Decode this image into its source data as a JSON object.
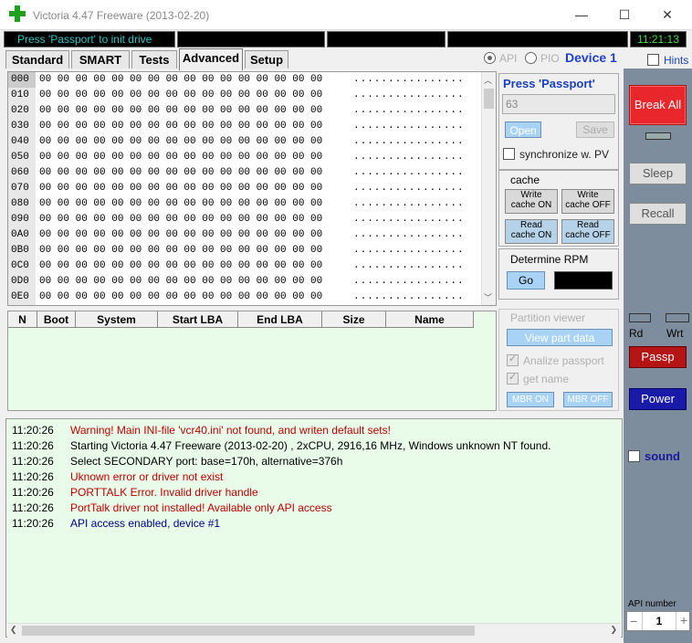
{
  "window": {
    "title": "Victoria 4.47  Freeware (2013-02-20)",
    "minimize": "—",
    "maximize": "☐",
    "close": "✕"
  },
  "status": {
    "message": "Press 'Passport' to init drive",
    "clock": "11:21:13"
  },
  "tabs": [
    {
      "label": "Standard"
    },
    {
      "label": "SMART"
    },
    {
      "label": "Tests"
    },
    {
      "label": "Advanced"
    },
    {
      "label": "Setup"
    }
  ],
  "mode": {
    "api": "API",
    "pio": "PIO",
    "device": "Device 1",
    "hints": "Hints"
  },
  "hex": {
    "rows": [
      {
        "addr": "000",
        "bytes": "00 00 00 00 00 00 00 00 00 00 00 00 00 00 00 00",
        "ascii": "................"
      },
      {
        "addr": "010",
        "bytes": "00 00 00 00 00 00 00 00 00 00 00 00 00 00 00 00",
        "ascii": "................"
      },
      {
        "addr": "020",
        "bytes": "00 00 00 00 00 00 00 00 00 00 00 00 00 00 00 00",
        "ascii": "................"
      },
      {
        "addr": "030",
        "bytes": "00 00 00 00 00 00 00 00 00 00 00 00 00 00 00 00",
        "ascii": "................"
      },
      {
        "addr": "040",
        "bytes": "00 00 00 00 00 00 00 00 00 00 00 00 00 00 00 00",
        "ascii": "................"
      },
      {
        "addr": "050",
        "bytes": "00 00 00 00 00 00 00 00 00 00 00 00 00 00 00 00",
        "ascii": "................"
      },
      {
        "addr": "060",
        "bytes": "00 00 00 00 00 00 00 00 00 00 00 00 00 00 00 00",
        "ascii": "................"
      },
      {
        "addr": "070",
        "bytes": "00 00 00 00 00 00 00 00 00 00 00 00 00 00 00 00",
        "ascii": "................"
      },
      {
        "addr": "080",
        "bytes": "00 00 00 00 00 00 00 00 00 00 00 00 00 00 00 00",
        "ascii": "................"
      },
      {
        "addr": "090",
        "bytes": "00 00 00 00 00 00 00 00 00 00 00 00 00 00 00 00",
        "ascii": "................"
      },
      {
        "addr": "0A0",
        "bytes": "00 00 00 00 00 00 00 00 00 00 00 00 00 00 00 00",
        "ascii": "................"
      },
      {
        "addr": "0B0",
        "bytes": "00 00 00 00 00 00 00 00 00 00 00 00 00 00 00 00",
        "ascii": "................"
      },
      {
        "addr": "0C0",
        "bytes": "00 00 00 00 00 00 00 00 00 00 00 00 00 00 00 00",
        "ascii": "................"
      },
      {
        "addr": "0D0",
        "bytes": "00 00 00 00 00 00 00 00 00 00 00 00 00 00 00 00",
        "ascii": "................"
      },
      {
        "addr": "0E0",
        "bytes": "00 00 00 00 00 00 00 00 00 00 00 00 00 00 00 00",
        "ascii": "................"
      }
    ]
  },
  "passport": {
    "title": "Press 'Passport'",
    "value": "63",
    "open": "Open",
    "save": "Save",
    "sync": "synchronize w. PV"
  },
  "cache": {
    "title": "cache",
    "write_on": [
      "Write",
      "cache ON"
    ],
    "write_off": [
      "Write",
      "cache OFF"
    ],
    "read_on": [
      "Read",
      "cache ON"
    ],
    "read_off": [
      "Read",
      "cache OFF"
    ]
  },
  "rpm": {
    "title": "Determine RPM",
    "go": "Go"
  },
  "partition_table": {
    "columns": [
      "N",
      "Boot",
      "System",
      "Start LBA",
      "End LBA",
      "Size",
      "Name"
    ]
  },
  "partition_viewer": {
    "title": "Partition viewer",
    "view": "View part data",
    "analize": "Analize passport",
    "getname": "get name",
    "mbr_on": "MBR ON",
    "mbr_off": "MBR OFF"
  },
  "log": [
    {
      "time": "11:20:26",
      "msg": "Warning! Main INI-file 'vcr40.ini' not found, and writen default sets!",
      "color": "#c00000"
    },
    {
      "time": "11:20:26",
      "msg": "Starting Victoria 4.47  Freeware (2013-02-20) , 2xCPU, 2916,16 MHz, Windows unknown NT found.",
      "color": "#000000"
    },
    {
      "time": "11:20:26",
      "msg": "Select SECONDARY port: base=170h, alternative=376h",
      "color": "#000000"
    },
    {
      "time": "11:20:26",
      "msg": "Uknown error or driver not exist",
      "color": "#c00000"
    },
    {
      "time": "11:20:26",
      "msg": "PORTTALK Error. Invalid driver handle",
      "color": "#c00000"
    },
    {
      "time": "11:20:26",
      "msg": "PortTalk driver not installed! Available only API access",
      "color": "#c00000"
    },
    {
      "time": "11:20:26",
      "msg": "API access enabled, device #1",
      "color": "#00008b"
    }
  ],
  "right": {
    "break_all": "Break All",
    "sleep": "Sleep",
    "recall": "Recall",
    "rd": "Rd",
    "wrt": "Wrt",
    "passp": "Passp",
    "power": "Power",
    "sound": "sound",
    "api_number_label": "API number",
    "api_number": "1",
    "minus": "−",
    "plus": "+"
  },
  "colors": {
    "break_red": "#e8262b",
    "passp_red": "#b41414",
    "power_blue": "#1a1aa8",
    "log_bg": "#e9fbe9",
    "clock_green": "#3ce03c",
    "status_cyan": "#29c3c3"
  }
}
